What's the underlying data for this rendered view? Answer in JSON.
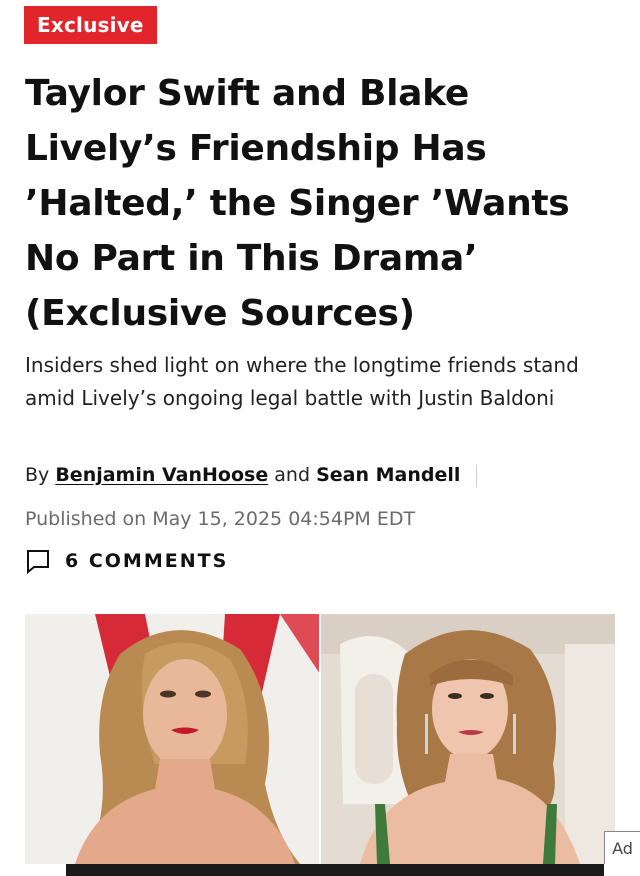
{
  "article": {
    "badge": "Exclusive",
    "headline": "Taylor Swift and Blake Lively’s Friendship Has ’Halted,’ the Singer ’Wants No Part in This Drama’ (Exclusive Sources)",
    "dek": "Insiders shed light on where the longtime friends stand amid Lively’s ongoing legal battle with Justin Baldoni",
    "byline": {
      "prefix": "By",
      "author1": "Benjamin VanHoose",
      "conjunction": "and",
      "author2": "Sean Mandell"
    },
    "published": "Published on May 15, 2025 04:54PM EDT",
    "comments": {
      "label": "6 COMMENTS",
      "icon": "comment-icon"
    }
  },
  "ad": {
    "label": "Ad"
  },
  "colors": {
    "badge_bg": "#e2252b",
    "text": "#111111",
    "muted": "#6b6b6b"
  }
}
